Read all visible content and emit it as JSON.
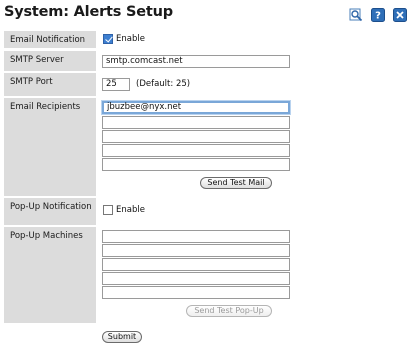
{
  "page": {
    "title": "System: Alerts Setup"
  },
  "toolbar": {
    "icons": [
      "search-icon",
      "help-icon",
      "close-icon"
    ]
  },
  "email_notification": {
    "label": "Email Notification",
    "checkbox_label": "Enable",
    "checked": true
  },
  "smtp_server": {
    "label": "SMTP Server",
    "value": "smtp.comcast.net"
  },
  "smtp_port": {
    "label": "SMTP Port",
    "value": "25",
    "hint": "(Default: 25)"
  },
  "email_recipients": {
    "label": "Email Recipients",
    "values": [
      "jbuzbee@nyx.net",
      "",
      "",
      "",
      ""
    ],
    "test_button": "Send Test Mail"
  },
  "popup_notification": {
    "label": "Pop-Up Notification",
    "checkbox_label": "Enable",
    "checked": false
  },
  "popup_machines": {
    "label": "Pop-Up Machines",
    "values": [
      "",
      "",
      "",
      "",
      ""
    ],
    "test_button": "Send Test Pop-Up"
  },
  "submit": {
    "label": "Submit"
  }
}
